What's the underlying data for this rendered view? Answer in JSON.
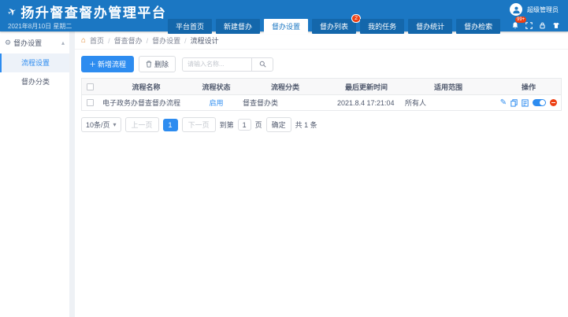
{
  "colors": {
    "header_blue": "#1b77c3",
    "tab_blue": "#1467ab",
    "accent_blue": "#2d8cf0",
    "badge_red": "#ed4014",
    "status_enabled_blue": "#2d8cf0",
    "active_item_bg": "#edf2f9"
  },
  "header": {
    "title": "扬升督查督办管理平台",
    "date": "2021年8月10日 星期二",
    "username": "超级管理员",
    "notice_badge": "99+"
  },
  "nav": {
    "tabs": [
      {
        "label": "平台首页"
      },
      {
        "label": "新建督办"
      },
      {
        "label": "督办设置"
      },
      {
        "label": "督办列表",
        "badge": "2"
      },
      {
        "label": "我的任务"
      },
      {
        "label": "督办统计"
      },
      {
        "label": "督办检索"
      }
    ]
  },
  "breadcrumb": {
    "separator": "/",
    "items": [
      "首页",
      "督查督办",
      "督办设置",
      "流程设计"
    ]
  },
  "sidebar": {
    "group": "督办设置",
    "items": [
      {
        "label": "流程设置"
      },
      {
        "label": "督办分类"
      }
    ]
  },
  "toolbar": {
    "add_label": "新增流程",
    "delete_label": "删除",
    "search_placeholder": "请输入名称..."
  },
  "table": {
    "columns": [
      "流程名称",
      "流程状态",
      "流程分类",
      "最后更新时间",
      "适用范围",
      "操作"
    ],
    "rows": [
      {
        "name": "电子政务办督查督办流程",
        "status": "启用",
        "category": "督查督办类",
        "updated": "2021.8.4 17:21:04",
        "scope": "所有人"
      }
    ]
  },
  "pagination": {
    "page_size": "10条/页",
    "prev": "上一页",
    "current": "1",
    "next": "下一页",
    "goto_prefix": "到第",
    "goto_value": "1",
    "goto_suffix": "页",
    "confirm": "确定",
    "total": "共 1 条"
  },
  "icons": {
    "logo": "✈",
    "gear": "⚙",
    "caret_up": "▴",
    "home": "⌂",
    "plus": "＋",
    "caret_down": "▾",
    "edit": "✎"
  }
}
